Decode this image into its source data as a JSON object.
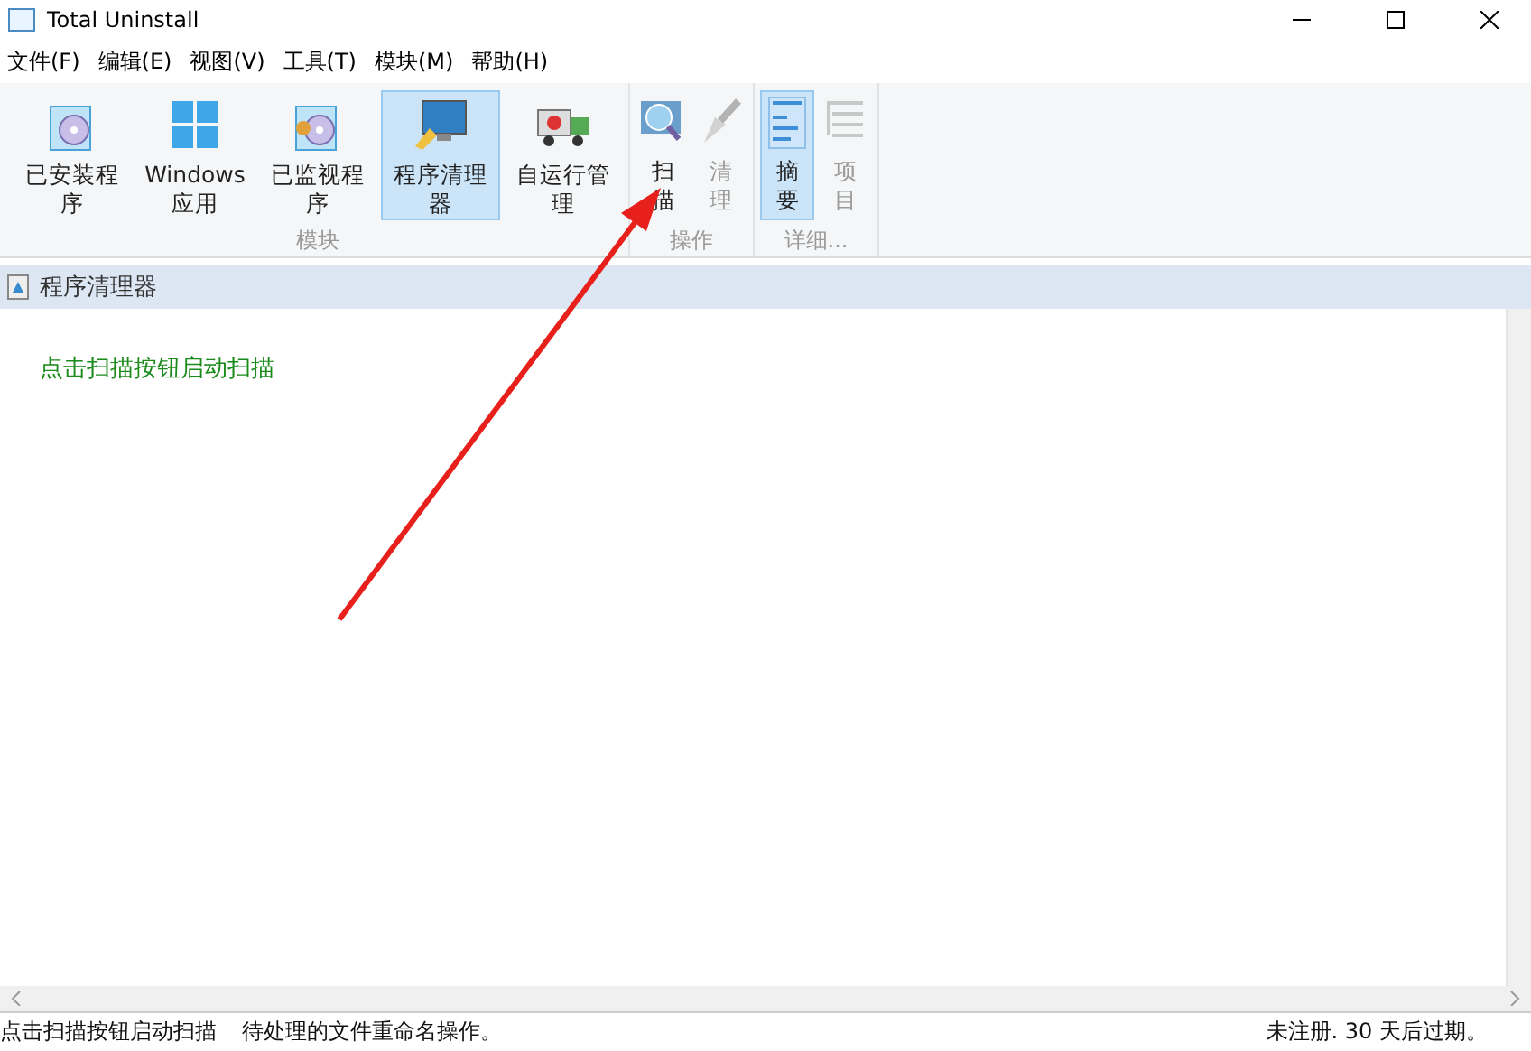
{
  "window": {
    "title": "Total Uninstall"
  },
  "menu": [
    "文件(F)",
    "编辑(E)",
    "视图(V)",
    "工具(T)",
    "模块(M)",
    "帮助(H)"
  ],
  "ribbon": [
    {
      "label": "模块",
      "buttons": [
        {
          "label": "已安装程序",
          "kind": "installed",
          "selected": false,
          "disabled": false
        },
        {
          "label": "Windows 应用",
          "kind": "windows",
          "selected": false,
          "disabled": false
        },
        {
          "label": "已监视程序",
          "kind": "monitored",
          "selected": false,
          "disabled": false
        },
        {
          "label": "程序清理器",
          "kind": "cleaner",
          "selected": true,
          "disabled": false
        },
        {
          "label": "自运行管理",
          "kind": "autorun",
          "selected": false,
          "disabled": false
        }
      ]
    },
    {
      "label": "操作",
      "buttons": [
        {
          "label": "扫描",
          "kind": "scan",
          "selected": false,
          "disabled": false
        },
        {
          "label": "清理",
          "kind": "broom",
          "selected": false,
          "disabled": true
        }
      ]
    },
    {
      "label": "详细...",
      "buttons": [
        {
          "label": "摘要",
          "kind": "summary",
          "selected": true,
          "disabled": false
        },
        {
          "label": "项目",
          "kind": "tree",
          "selected": false,
          "disabled": true
        }
      ]
    }
  ],
  "panel": {
    "title": "程序清理器",
    "message": "点击扫描按钮启动扫描"
  },
  "status_bar": {
    "left": [
      "点击扫描按钮启动扫描",
      "待处理的文件重命名操作。"
    ],
    "right": "未注册. 30 天后过期。"
  }
}
